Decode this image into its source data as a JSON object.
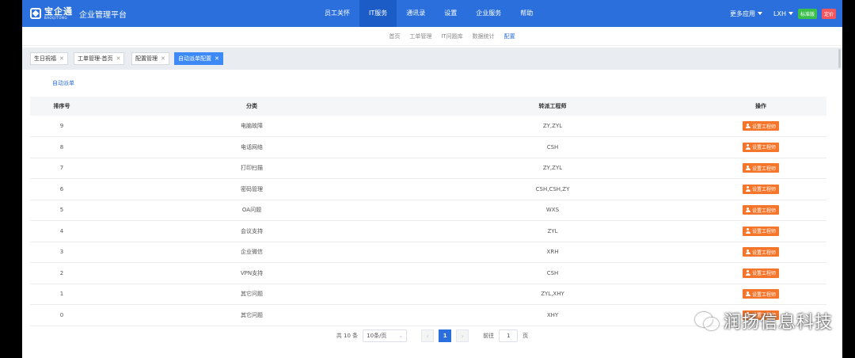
{
  "brand": {
    "logo_cn": "宝企通",
    "logo_en": "BAOQITONG",
    "app_title": "企业管理平台"
  },
  "main_nav": [
    "员工关怀",
    "IT服务",
    "通讯录",
    "设置",
    "企业服务",
    "帮助"
  ],
  "main_nav_active": "IT服务",
  "top_right": {
    "more_apps": "更多应用",
    "user": "LXH",
    "edition_badge": "标准版",
    "pricing_badge": "定价"
  },
  "sub_nav": [
    "首页",
    "工单管理",
    "IT问题库",
    "数据统计",
    "配置"
  ],
  "sub_nav_active": "配置",
  "tabs": [
    "生日祝福",
    "工单管理-首页",
    "配置管理",
    "自动派单配置"
  ],
  "tabs_active": "自动派单配置",
  "auto_dispatch_link": "自动派单",
  "table": {
    "headers": [
      "排序号",
      "分类",
      "转派工程师",
      "操作"
    ],
    "action_label": "设置工程师",
    "rows": [
      {
        "order": "9",
        "category": "电脑故障",
        "engineers": "ZY,ZYL"
      },
      {
        "order": "8",
        "category": "电话网络",
        "engineers": "CSH"
      },
      {
        "order": "7",
        "category": "打印扫描",
        "engineers": "ZY,ZYL"
      },
      {
        "order": "6",
        "category": "密码管理",
        "engineers": "CSH,CSH,ZY"
      },
      {
        "order": "5",
        "category": "OA问题",
        "engineers": "WXS"
      },
      {
        "order": "4",
        "category": "会议支持",
        "engineers": "ZYL"
      },
      {
        "order": "3",
        "category": "企业微信",
        "engineers": "XRH"
      },
      {
        "order": "2",
        "category": "VPN支持",
        "engineers": "CSH"
      },
      {
        "order": "1",
        "category": "其它问题",
        "engineers": "ZYL,XHY"
      },
      {
        "order": "0",
        "category": "其它问题",
        "engineers": "XHY"
      }
    ]
  },
  "pagination": {
    "total": "共 10 条",
    "page_size": "10条/页",
    "current_page": "1",
    "goto_label": "前往",
    "goto_value": "1",
    "page_unit": "页"
  },
  "watermark": "润扬信息科技",
  "colors": {
    "primary": "#2a6fdb",
    "action": "#f5752a",
    "active_tab": "#3d8af7"
  }
}
